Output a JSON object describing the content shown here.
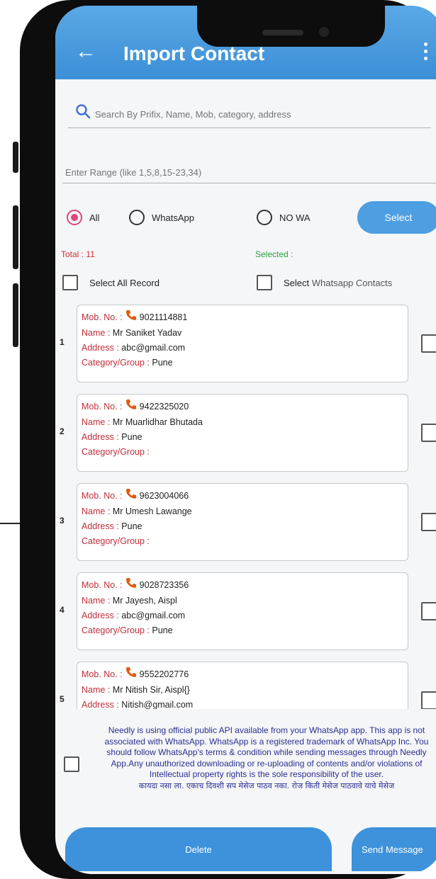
{
  "appbar": {
    "title": "Import Contact"
  },
  "search": {
    "placeholder": "Search By Prifix, Name, Mob, category, address"
  },
  "range": {
    "placeholder": "Enter Range (like 1,5,8,15-23,34)"
  },
  "filters": {
    "options": [
      "All",
      "WhatsApp",
      "NO WA"
    ],
    "selected": "All",
    "select_label": "Select"
  },
  "counts": {
    "total": "Total : 11",
    "selected": "Selected :"
  },
  "select_all": {
    "record_label": "Select All Record",
    "wa_prefix": "Select",
    "wa_rest": " Whatsapp Contacts"
  },
  "labels": {
    "mob": "Mob. No. :",
    "name": "Name :",
    "address": "Address :",
    "category": "Category/Group :"
  },
  "contacts": [
    {
      "index": "1",
      "mob": "9021114881",
      "name": "Mr Saniket Yadav",
      "address": "abc@gmail.com",
      "category": "Pune"
    },
    {
      "index": "2",
      "mob": "9422325020",
      "name": "Mr Muarlidhar Bhutada",
      "address": "Pune",
      "category": ""
    },
    {
      "index": "3",
      "mob": "9623004066",
      "name": "Mr Umesh Lawange",
      "address": "Pune",
      "category": ""
    },
    {
      "index": "4",
      "mob": "9028723356",
      "name": "Mr Jayesh, Aispl",
      "address": "abc@gmail.com",
      "category": "Pune"
    },
    {
      "index": "5",
      "mob": "9552202776",
      "name": "Mr Nitish Sir, Aispl{}",
      "address": "Nitish@gmail.com",
      "category": ""
    }
  ],
  "disclaimer": {
    "english": "Needly is using official public API available from your WhatsApp app. This app is not associated with WhatsApp. WhatsApp is a registered trademark of WhatsApp Inc. You should follow WhatsApp's terms & condition while sending messages through Needly App.Any unauthorized downloading or re-uploading of contents and/or violations of Intellectual property rights is the sole responsibility of the user.",
    "marathi": "कायदा नसा ला. एकाच दिवशी सप मेसेज पाठव नका. रोज किती मेसेज पाठवावे याचे मेसेज"
  },
  "actions": {
    "delete": "Delete",
    "send": "Send Message"
  },
  "colors": {
    "primary": "#3d92db",
    "label_red": "#c0303a",
    "selected_green": "#2e9e3e",
    "radio_pink": "#e0457b",
    "disclaimer_blue": "#2b2f8f"
  },
  "icons": {
    "back": "arrow-left-icon",
    "more": "more-vert-icon",
    "search": "search-icon",
    "phone": "phone-icon"
  }
}
